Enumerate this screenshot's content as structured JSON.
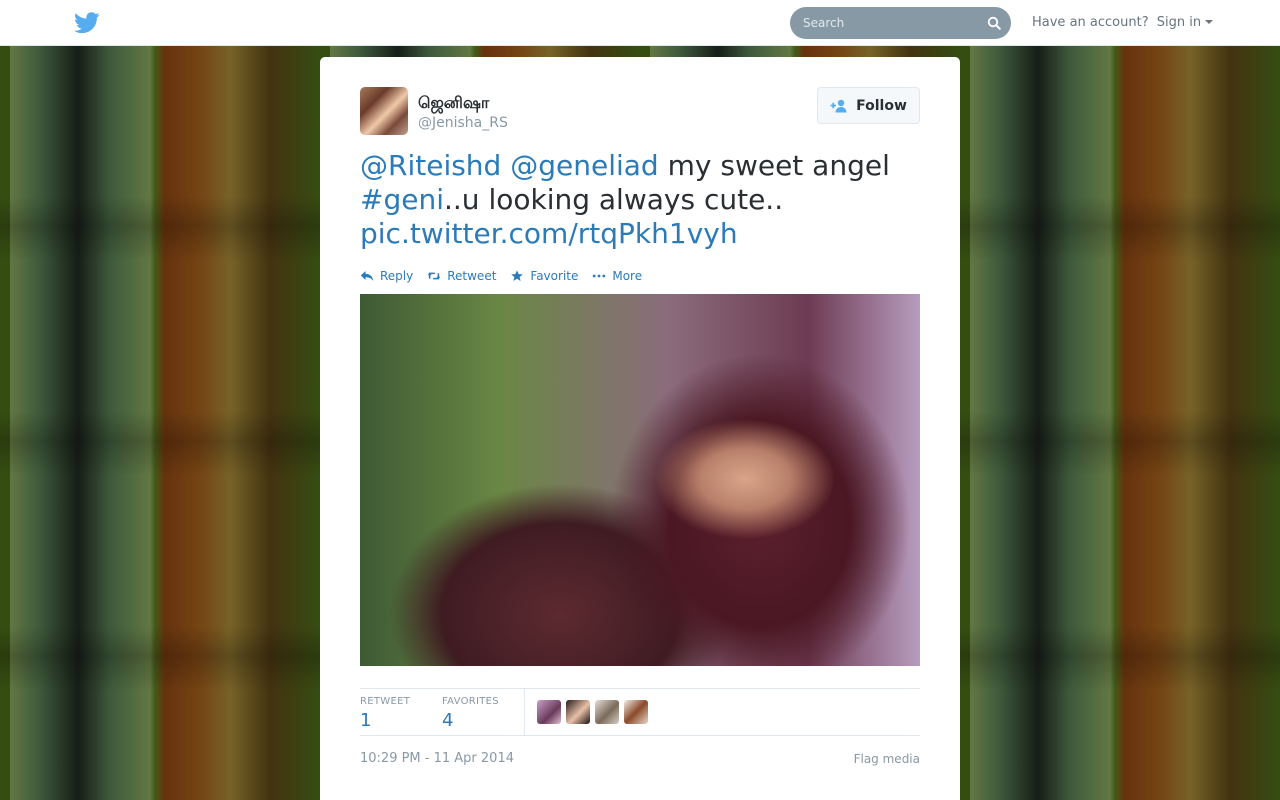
{
  "header": {
    "search_placeholder": "Search",
    "have_account": "Have an account?",
    "sign_in": "Sign in"
  },
  "tweet": {
    "fullname": "ஜெனிஷா",
    "screen_name": "@Jenisha_RS",
    "follow_label": "Follow",
    "text": {
      "mention1": "@Riteishd",
      "mention2": "@geneliad",
      "part1": "my sweet angel",
      "hashtag": "#geni",
      "part2": "..u looking always cute..",
      "link": "pic.twitter.com/rtqPkh1vyh"
    },
    "actions": {
      "reply": "Reply",
      "retweet": "Retweet",
      "favorite": "Favorite",
      "more": "More"
    },
    "stats": {
      "retweets_label": "RETWEET",
      "retweets": "1",
      "favorites_label": "FAVORITES",
      "favorites": "4"
    },
    "timestamp": "10:29 PM - 11 Apr 2014",
    "flag_media": "Flag media"
  },
  "colors": {
    "link": "#2b7bb9",
    "muted": "#8899a6",
    "brand": "#55acee"
  }
}
